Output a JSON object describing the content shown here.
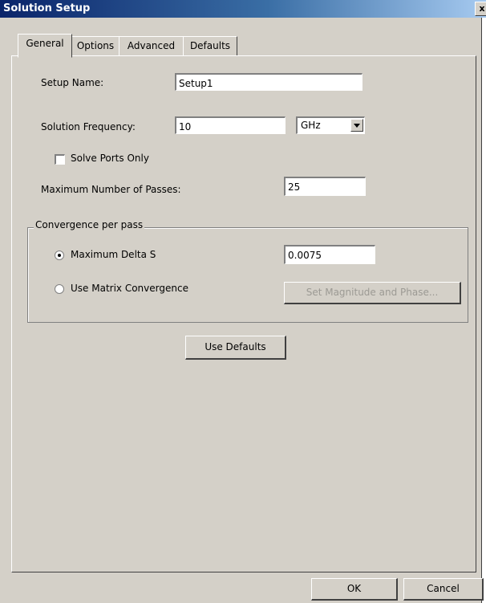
{
  "window": {
    "title": "Solution Setup",
    "close_glyph": "x"
  },
  "tabs": [
    {
      "label": "General",
      "active": true
    },
    {
      "label": "Options",
      "active": false
    },
    {
      "label": "Advanced",
      "active": false
    },
    {
      "label": "Defaults",
      "active": false
    }
  ],
  "general": {
    "setup_name_label": "Setup Name:",
    "setup_name_value": "Setup1",
    "frequency_label": "Solution Frequency:",
    "frequency_value": "10",
    "frequency_unit": "GHz",
    "solve_ports_label": "Solve Ports Only",
    "solve_ports_checked": false,
    "max_passes_label": "Maximum Number of Passes:",
    "max_passes_value": "25"
  },
  "convergence": {
    "group_title": "Convergence per pass",
    "max_delta_label": "Maximum Delta S",
    "max_delta_selected": true,
    "max_delta_value": "0.0075",
    "matrix_label": "Use Matrix Convergence",
    "matrix_selected": false,
    "set_mag_phase_label": "Set Magnitude and Phase..."
  },
  "buttons": {
    "use_defaults": "Use Defaults",
    "ok": "OK",
    "cancel": "Cancel"
  },
  "colors": {
    "dialog_face": "#d4d0c8",
    "title_bar": "#0a246a",
    "disabled_text": "#9c9a94"
  }
}
